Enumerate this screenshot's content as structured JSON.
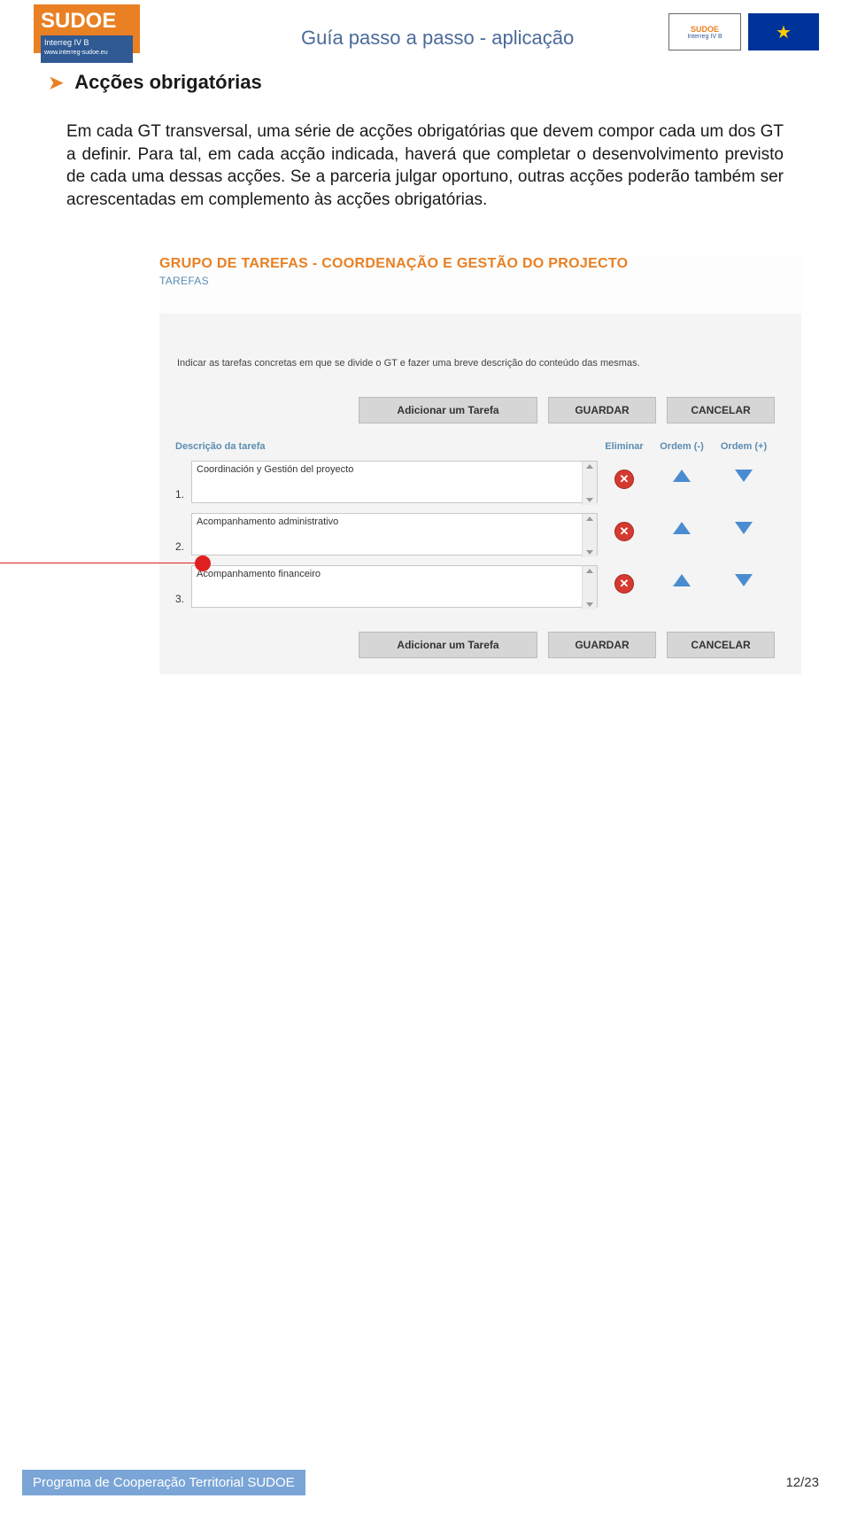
{
  "header": {
    "logo_main": "SUDOE",
    "logo_sub": "Interreg IV B",
    "logo_url": "www.interreg-sudoe.eu",
    "title": "Guía passo a passo - aplicação",
    "right_logo_top": "SUDOE",
    "right_logo_sub": "Interreg IV B"
  },
  "section": {
    "title": "Acções obrigatórias"
  },
  "body": {
    "paragraph": "Em cada GT transversal, uma série de acções obrigatórias que devem compor cada um dos GT a definir. Para tal, em cada acção indicada, haverá que completar o desenvolvimento previsto de cada uma dessas acções. Se a parceria julgar oportuno, outras acções poderão também ser acrescentadas em complemento às acções obrigatórias."
  },
  "ui": {
    "title": "GRUPO DE TAREFAS - COORDENAÇÃO E GESTÃO DO PROJECTO",
    "subtitle": "TAREFAS",
    "instruction": "Indicar as tarefas concretas em que se divide o GT e fazer uma breve descrição do conteúdo das mesmas.",
    "btn_add": "Adicionar um Tarefa",
    "btn_save": "GUARDAR",
    "btn_cancel": "CANCELAR",
    "col_desc": "Descrição da tarefa",
    "col_elim": "Eliminar",
    "col_up": "Ordem (-)",
    "col_down": "Ordem (+)",
    "tasks": [
      {
        "num": "1.",
        "text": "Coordinación y Gestión del proyecto"
      },
      {
        "num": "2.",
        "text": "Acompanhamento administrativo"
      },
      {
        "num": "3.",
        "text": "Acompanhamento financeiro"
      }
    ]
  },
  "footer": {
    "program": "Programa de Cooperação Territorial SUDOE",
    "page": "12/23"
  }
}
